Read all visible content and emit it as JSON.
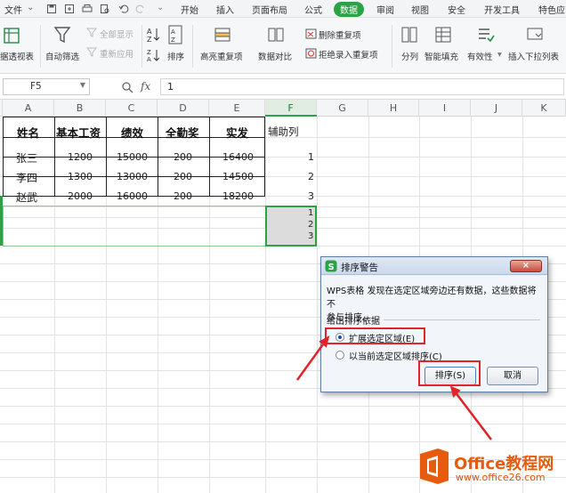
{
  "menu": {
    "file_label": "文件",
    "items": [
      "开始",
      "插入",
      "页面布局",
      "公式",
      "数据",
      "审阅",
      "视图",
      "安全",
      "开发工具",
      "特色应"
    ],
    "active": "数据"
  },
  "ribbon": {
    "pivot_label": "据透视表",
    "autofilter_label": "自动筛选",
    "show_all_label": "全部显示",
    "reapply_label": "重新应用",
    "sort_label": "排序",
    "highlight_dup_label": "高亮重复项",
    "compare_label": "数据对比",
    "remove_dup_label": "删除重复项",
    "reject_dup_label": "拒绝录入重复项",
    "split_label": "分列",
    "smart_fill_label": "智能填充",
    "validity_label": "有效性",
    "insert_dropdown_label": "插入下拉列表"
  },
  "formula_bar": {
    "cell_ref": "F5",
    "fx": "fx",
    "value": "1"
  },
  "sheet": {
    "columns": [
      "A",
      "B",
      "C",
      "D",
      "E",
      "F",
      "G",
      "H",
      "I",
      "J",
      "K"
    ],
    "selected_column": "F",
    "table_headers": [
      "姓名",
      "基本工资",
      "绩效",
      "全勤奖",
      "实发",
      "辅助列"
    ],
    "rows": [
      [
        "张三",
        "1200",
        "15000",
        "200",
        "16400",
        "1"
      ],
      [
        "李四",
        "1300",
        "13000",
        "200",
        "14500",
        "2"
      ],
      [
        "赵武",
        "2000",
        "16000",
        "200",
        "18200",
        "3"
      ]
    ],
    "extra_f_values": [
      "1",
      "2",
      "3"
    ]
  },
  "dialog": {
    "title": "排序警告",
    "message_line1": "WPS表格 发现在选定区域旁边还有数据，这些数据将不",
    "message_line2": "参与排序。",
    "group_label": "给出排序依据",
    "option_expand": "扩展选定区域(E)",
    "option_current": "以当前选定区域排序(C)",
    "selected_option": "expand",
    "sort_button": "排序(S)",
    "cancel_button": "取消",
    "close_glyph": "×"
  },
  "watermark": {
    "brand": "Office教程网",
    "url": "www.office26.com"
  },
  "colors": {
    "accent_green": "#2ba245",
    "annotation_red": "#e0242b",
    "logo_orange": "#e65b0e"
  }
}
